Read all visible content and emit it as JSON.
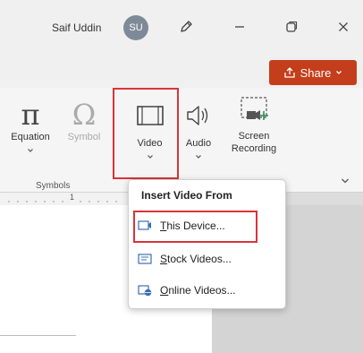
{
  "titlebar": {
    "user_name": "Saif Uddin",
    "avatar_initials": "SU",
    "icons": [
      "pen-icon",
      "minimize-icon",
      "restore-icon",
      "close-icon"
    ]
  },
  "share": {
    "label": "Share",
    "icon": "share-icon",
    "color": "#c43e1c"
  },
  "ribbon": {
    "equation": {
      "glyph": "π",
      "label": "Equation"
    },
    "symbol": {
      "glyph": "Ω",
      "label": "Symbol"
    },
    "video": {
      "label": "Video"
    },
    "audio": {
      "label": "Audio"
    },
    "screen_recording": {
      "label_line1": "Screen",
      "label_line2": "Recording"
    },
    "group_label": "Symbols",
    "ruler_mark": "1"
  },
  "dropdown": {
    "title": "Insert Video From",
    "items": [
      {
        "hotkey": "T",
        "rest": "his Device...",
        "icon": "device-video-icon"
      },
      {
        "hotkey": "S",
        "rest": "tock Videos...",
        "icon": "stock-video-icon"
      },
      {
        "hotkey": "O",
        "rest": "nline Videos...",
        "icon": "online-video-icon"
      }
    ]
  },
  "highlight_color": "#d9343a"
}
